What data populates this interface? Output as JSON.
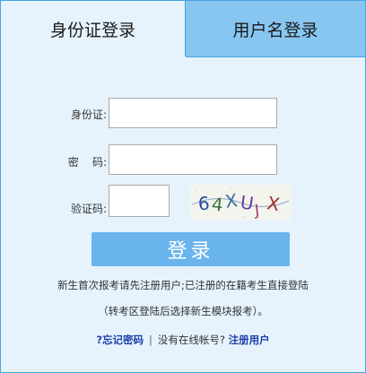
{
  "tabs": [
    {
      "label": "身份证登录",
      "active": true
    },
    {
      "label": "用户名登录",
      "active": false
    }
  ],
  "form": {
    "id_label": "身份证:",
    "password_label": "密    码:",
    "captcha_label": "验证码:",
    "id_value": "",
    "password_value": "",
    "captcha_value": ""
  },
  "captcha": {
    "text": "64XUJX"
  },
  "login_button_label": "登录",
  "notice": {
    "line1": "新生首次报考请先注册用户;已注册的在籍考生直接登陆",
    "line2": "（转考区登陆后选择新生模块报考）。"
  },
  "links": {
    "forgot_password": "?忘记密码",
    "separator": "|",
    "no_account_text": "没有在线帐号?",
    "register": "注册用户"
  },
  "colors": {
    "panel_bg": "#e6f3fd",
    "border": "#4aa3e0",
    "inactive_tab_bg": "#88c6f2",
    "button_bg": "#6ab4ee",
    "link": "#1c3fa8"
  }
}
